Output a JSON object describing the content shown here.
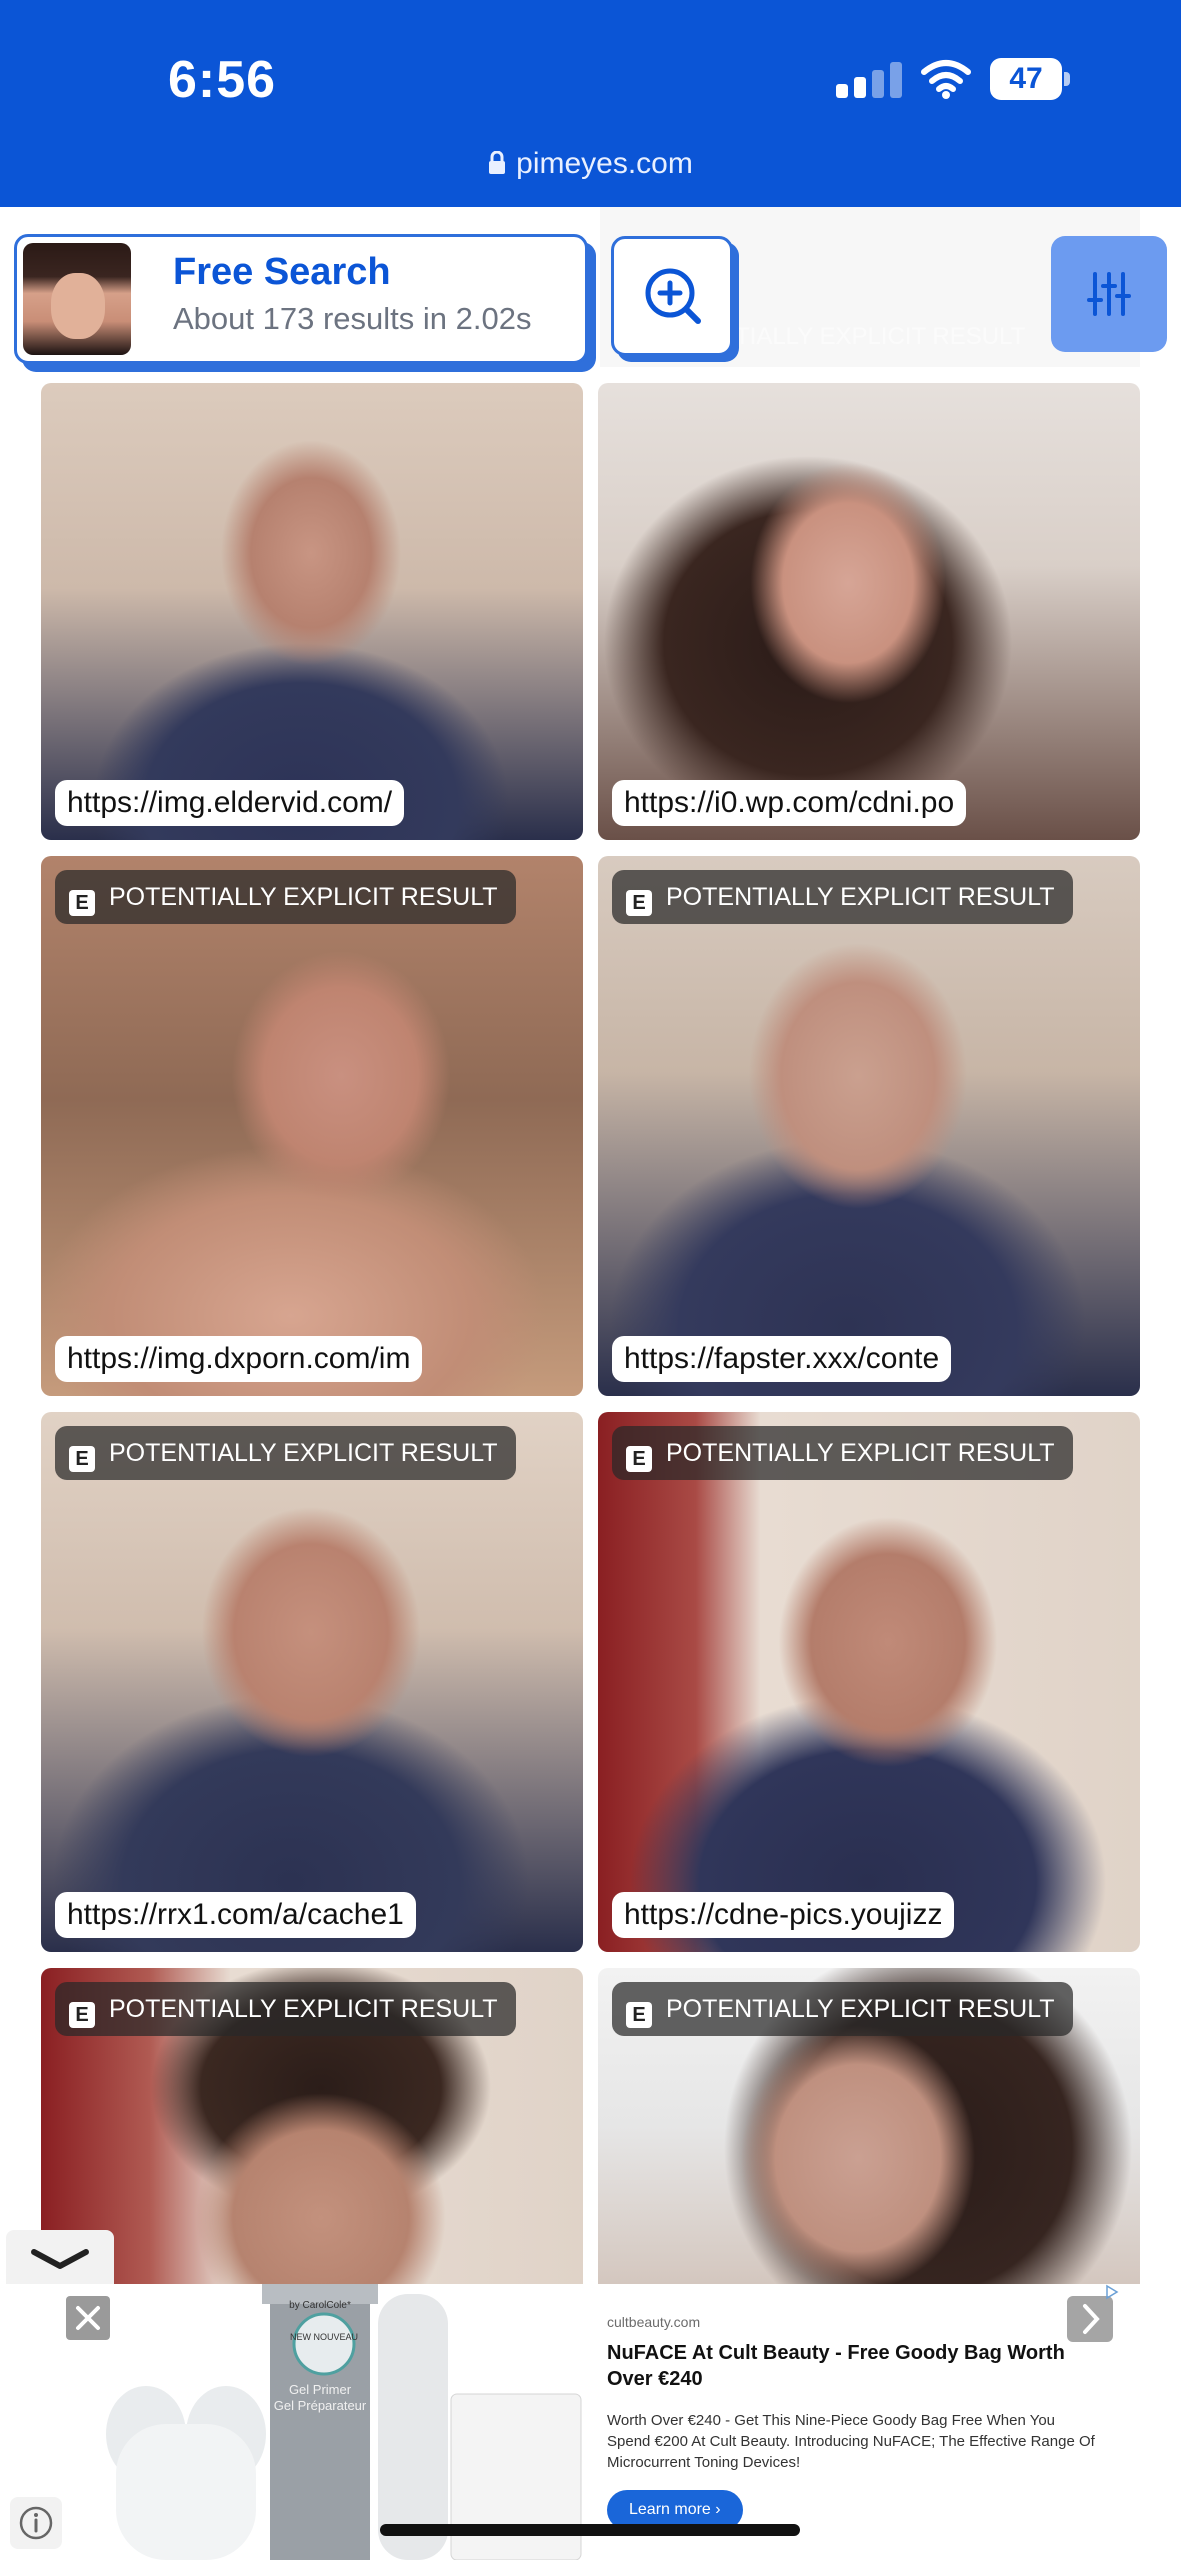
{
  "status_bar": {
    "time": "6:56",
    "battery_level": "47",
    "url": "pimeyes.com"
  },
  "search_card": {
    "title": "Free Search",
    "subtitle": "About 173 results in 2.02s"
  },
  "ghost_label": "TIALLY EXPLICIT RESULT",
  "badge_label": "POTENTIALLY EXPLICIT RESULT",
  "badge_letter": "E",
  "results": [
    {
      "url": "https://img.eldervid.com/",
      "explicit": false
    },
    {
      "url": "https://i0.wp.com/cdni.po",
      "explicit": false
    },
    {
      "url": "https://img.dxporn.com/im",
      "explicit": true
    },
    {
      "url": "https://fapster.xxx/conte",
      "explicit": true
    },
    {
      "url": "https://rrx1.com/a/cache1",
      "explicit": true
    },
    {
      "url": "https://cdne-pics.youjizz",
      "explicit": true
    },
    {
      "url": "",
      "explicit": true
    },
    {
      "url": "",
      "explicit": true
    }
  ],
  "ad": {
    "domain": "cultbeauty.com",
    "title": "NuFACE At Cult Beauty - Free Goody Bag Worth Over €240",
    "description": "Worth Over €240 - Get This Nine-Piece Goody Bag Free When You Spend €200 At Cult Beauty. Introducing NuFACE; The Effective Range Of Microcurrent Toning Devices!",
    "cta": "Learn more",
    "brand_sub": "by CarolCole*",
    "product_badge": "NEW NOUVEAU",
    "product_text_1": "Gel Primer",
    "product_text_2": "Gel Préparateur"
  },
  "colors": {
    "brand_blue": "#0b55d6",
    "accent_blue": "#2f6fdb",
    "filter_blue": "#6c9bf0"
  },
  "icons": {
    "lock": "lock-icon",
    "zoom": "zoom-plus-icon",
    "filter": "filter-sliders-icon",
    "collapse": "chevron-down-icon",
    "ad_close": "close-icon",
    "ad_next": "chevron-right-icon",
    "info": "info-icon"
  }
}
